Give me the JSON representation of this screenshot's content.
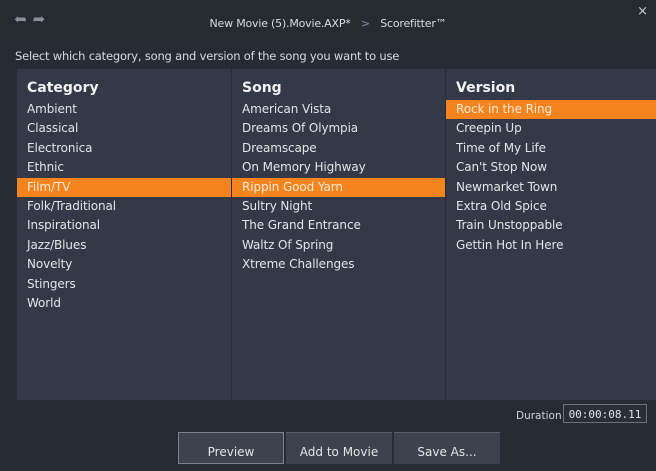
{
  "titlebar": {
    "back_icon": "back-arrow-icon",
    "forward_icon": "forward-arrow-icon",
    "project": "New Movie (5).Movie.AXP*",
    "separator": ">",
    "tool": "Scorefitter™",
    "close": "×"
  },
  "instruction": "Select which category, song and version of the song you want to use",
  "category": {
    "header": "Category",
    "items": [
      "Ambient",
      "Classical",
      "Electronica",
      "Ethnic",
      "Film/TV",
      "Folk/Traditional",
      "Inspirational",
      "Jazz/Blues",
      "Novelty",
      "Stingers",
      "World"
    ],
    "selected": "Film/TV"
  },
  "song": {
    "header": "Song",
    "items": [
      "American Vista",
      "Dreams Of Olympia",
      "Dreamscape",
      "On Memory Highway",
      "Rippin Good Yarn",
      "Sultry Night",
      "The Grand Entrance",
      "Waltz Of Spring",
      "Xtreme Challenges"
    ],
    "selected": "Rippin Good Yarn"
  },
  "version": {
    "header": "Version",
    "items": [
      "Rock in the Ring",
      "Creepin Up",
      "Time of My Life",
      "Can't Stop Now",
      "Newmarket Town",
      "Extra Old Spice",
      "Train Unstoppable",
      "Gettin Hot In Here"
    ],
    "selected": "Rock in the Ring"
  },
  "duration": {
    "label": "Duration",
    "value": "00:00:08.11"
  },
  "buttons": {
    "preview": "Preview",
    "add_to_movie": "Add to Movie",
    "save_as": "Save As..."
  },
  "colors": {
    "selection": "#f5841f",
    "panel": "#333946",
    "background": "#272c34"
  }
}
